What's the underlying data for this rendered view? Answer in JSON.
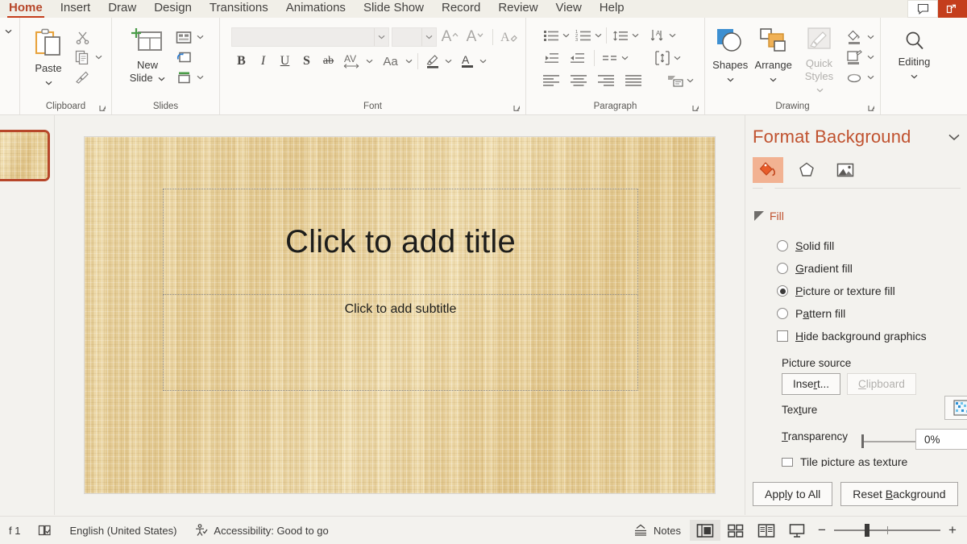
{
  "tabs": [
    {
      "label": "Home",
      "active": true
    },
    {
      "label": "Insert",
      "active": false
    },
    {
      "label": "Draw",
      "active": false
    },
    {
      "label": "Design",
      "active": false
    },
    {
      "label": "Transitions",
      "active": false
    },
    {
      "label": "Animations",
      "active": false
    },
    {
      "label": "Slide Show",
      "active": false
    },
    {
      "label": "Record",
      "active": false
    },
    {
      "label": "Review",
      "active": false
    },
    {
      "label": "View",
      "active": false
    },
    {
      "label": "Help",
      "active": false
    }
  ],
  "titlebar": {
    "comment_icon": "comment-icon",
    "share_icon": "share-icon"
  },
  "ribbon": {
    "clipboard": {
      "label": "Clipboard",
      "paste_label": "Paste",
      "cut_icon": "scissors-icon",
      "copy_icon": "copy-icon",
      "format_painter_icon": "format-painter-icon",
      "launcher_icon": "dialog-launcher-icon"
    },
    "slides": {
      "label": "Slides",
      "new_slide_label": "New\nSlide",
      "new_slide_line1": "New",
      "new_slide_line2": "Slide",
      "layout_icon": "slide-layout-icon",
      "reset_icon": "slide-reset-icon",
      "section_icon": "slide-section-icon"
    },
    "font": {
      "label": "Font",
      "font_name_value": "",
      "font_size_value": "",
      "grow_label": "A",
      "shrink_label": "A",
      "clear_formatting_icon": "clear-formatting-icon",
      "bold_label": "B",
      "italic_label": "I",
      "underline_label": "U",
      "shadow_label": "S",
      "strikethrough_label": "ab",
      "character_spacing_label": "AV",
      "change_case_label": "Aa",
      "text_highlight_icon": "text-highlight-icon",
      "font_color_label": "A",
      "launcher_icon": "dialog-launcher-icon"
    },
    "paragraph": {
      "label": "Paragraph",
      "bullets_icon": "bullets-icon",
      "numbering_icon": "numbering-icon",
      "line_spacing_icon": "line-spacing-icon",
      "text_direction_icon": "text-direction-icon",
      "decrease_indent_icon": "decrease-indent-icon",
      "increase_indent_icon": "increase-indent-icon",
      "columns_icon": "columns-icon",
      "align_text_icon": "align-text-vertical-icon",
      "align_left_icon": "align-left-icon",
      "align_center_icon": "align-center-icon",
      "align_right_icon": "align-right-icon",
      "justify_icon": "justify-icon",
      "smartart_icon": "convert-to-smartart-icon",
      "launcher_icon": "dialog-launcher-icon"
    },
    "drawing": {
      "label": "Drawing",
      "shapes_label": "Shapes",
      "arrange_label": "Arrange",
      "quick_styles_line1": "Quick",
      "quick_styles_line2": "Styles",
      "shape_fill_icon": "shape-fill-icon",
      "shape_outline_icon": "shape-outline-icon",
      "shape_effects_icon": "shape-effects-icon",
      "launcher_icon": "dialog-launcher-icon"
    },
    "editing": {
      "label": "Editing",
      "icon": "magnifier-icon"
    }
  },
  "slide": {
    "title_placeholder": "Click to add title",
    "subtitle_placeholder": "Click to add subtitle",
    "background_color": "#e9d4a0",
    "texture_name": "papyrus"
  },
  "panel": {
    "title": "Format Background",
    "close_icon": "chevron-down-icon",
    "icons": [
      {
        "name": "fill-icon",
        "selected": true
      },
      {
        "name": "effects-pentagon-icon",
        "selected": false
      },
      {
        "name": "picture-icon",
        "selected": false
      }
    ],
    "fill_section": {
      "label": "Fill",
      "options": [
        {
          "label": "Solid fill",
          "accel": "S",
          "selected": false
        },
        {
          "label": "Gradient fill",
          "accel": "G",
          "selected": false
        },
        {
          "label": "Picture or texture fill",
          "accel": "P",
          "selected": true
        },
        {
          "label": "Pattern fill",
          "accel": "a",
          "selected": false
        }
      ],
      "hide_background_graphics": {
        "label": "Hide background graphics",
        "accel": "H",
        "checked": false
      }
    },
    "picture_source_label": "Picture source",
    "insert_button": "Insert...",
    "clipboard_button": "Clipboard",
    "texture_label": "Texture",
    "texture_swatch_icon": "texture-swatch-icon",
    "transparency_label": "Transparency",
    "transparency_value": "0%",
    "tile_label": "Tile picture as texture",
    "apply_to_all_button": "Apply to All",
    "reset_background_button": "Reset Background"
  },
  "statusbar": {
    "slide_count": "f 1",
    "spellcheck_icon": "spellcheck-icon",
    "language": "English (United States)",
    "accessibility_icon": "accessibility-icon",
    "accessibility": "Accessibility: Good to go",
    "notes_label": "Notes",
    "notes_icon": "notes-caret-icon",
    "views": [
      {
        "name": "normal-view-icon",
        "active": true
      },
      {
        "name": "slide-sorter-view-icon",
        "active": false
      },
      {
        "name": "reading-view-icon",
        "active": false
      },
      {
        "name": "slide-show-view-icon",
        "active": false
      }
    ],
    "zoom_minus": "−",
    "zoom_plus": "+"
  },
  "colors": {
    "accent": "#c43e1c",
    "panel_title": "#c0522f",
    "chrome": "#f3f2ee"
  }
}
